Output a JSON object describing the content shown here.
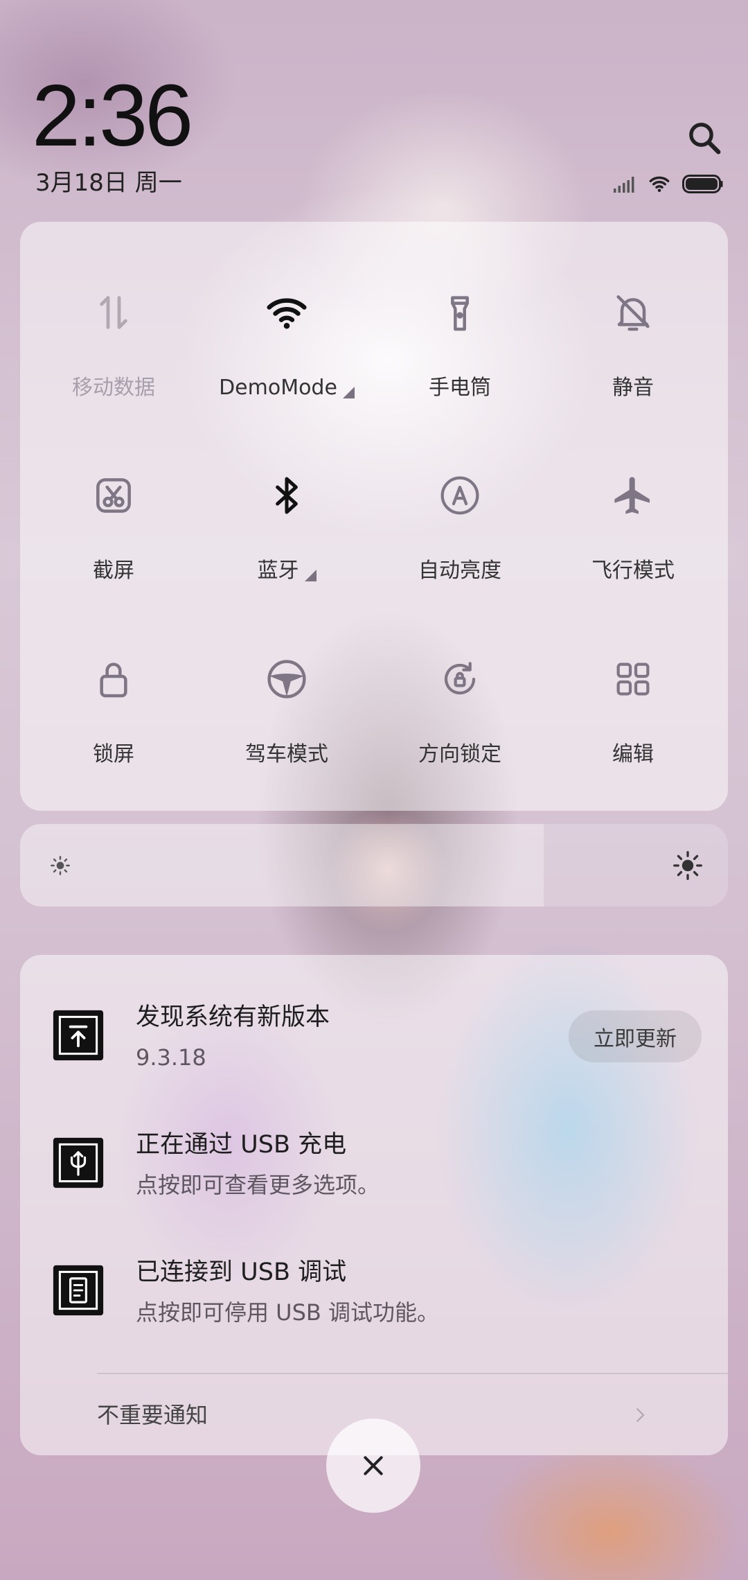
{
  "status_bar": {
    "time": "2:36",
    "date": "3月18日 周一",
    "icons": {
      "search": "search-icon",
      "signal": "signal-icon",
      "wifi": "wifi-icon",
      "battery": "battery-icon"
    },
    "battery_level": 1.0
  },
  "quick_settings": {
    "tiles": [
      {
        "label": "移动数据",
        "icon": "mobile-data-icon",
        "active": false,
        "disabled": true,
        "expandable": false
      },
      {
        "label": "DemoMode",
        "icon": "wifi-icon",
        "active": true,
        "disabled": false,
        "expandable": true
      },
      {
        "label": "手电筒",
        "icon": "flashlight-icon",
        "active": false,
        "disabled": false,
        "expandable": false
      },
      {
        "label": "静音",
        "icon": "mute-icon",
        "active": false,
        "disabled": false,
        "expandable": false
      },
      {
        "label": "截屏",
        "icon": "screenshot-icon",
        "active": false,
        "disabled": false,
        "expandable": false
      },
      {
        "label": "蓝牙",
        "icon": "bluetooth-icon",
        "active": true,
        "disabled": false,
        "expandable": true
      },
      {
        "label": "自动亮度",
        "icon": "auto-brightness-icon",
        "active": false,
        "disabled": false,
        "expandable": false
      },
      {
        "label": "飞行模式",
        "icon": "airplane-icon",
        "active": false,
        "disabled": false,
        "expandable": false
      },
      {
        "label": "锁屏",
        "icon": "lock-icon",
        "active": false,
        "disabled": false,
        "expandable": false
      },
      {
        "label": "驾车模式",
        "icon": "steering-wheel-icon",
        "active": false,
        "disabled": false,
        "expandable": false
      },
      {
        "label": "方向锁定",
        "icon": "rotation-lock-icon",
        "active": false,
        "disabled": false,
        "expandable": false
      },
      {
        "label": "编辑",
        "icon": "edit-grid-icon",
        "active": false,
        "disabled": false,
        "expandable": false
      }
    ]
  },
  "brightness": {
    "level": 0.74,
    "icon_low": "brightness-low-icon",
    "icon_high": "brightness-high-icon"
  },
  "notifications": [
    {
      "title": "发现系统有新版本",
      "text": "9.3.18",
      "icon": "system-update-icon",
      "action": "立即更新"
    },
    {
      "title": "正在通过 USB 充电",
      "text": "点按即可查看更多选项。",
      "icon": "usb-icon"
    },
    {
      "title": "已连接到 USB 调试",
      "text": "点按即可停用 USB 调试功能。",
      "icon": "usb-debug-icon"
    }
  ],
  "unimportant_notifications": {
    "label": "不重要通知",
    "icon": "chevron-right-icon"
  },
  "close_button": {
    "icon": "close-icon"
  },
  "colors": {
    "active_icon": "#111111",
    "inactive_icon": "#7e7684",
    "disabled": "#b0a8b3",
    "panel": "rgba(255,255,255,0.5)"
  }
}
